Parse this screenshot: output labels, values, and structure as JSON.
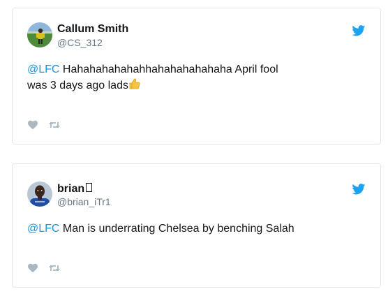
{
  "tweets": [
    {
      "author_name": "Callum Smith",
      "author_handle": "@CS_312",
      "mention": "@LFC",
      "text_line1": " Hahahahahahahhahahahahahaha April fool",
      "text_line2": "was 3 days ago lads"
    },
    {
      "author_name": "brian",
      "author_handle": "@brian_iTr1",
      "mention": "@LFC",
      "text": " Man is underrating Chelsea by benching Salah"
    }
  ],
  "icons": {
    "brand": "twitter-bird-icon",
    "like": "heart-icon",
    "retweet": "retweet-icon",
    "emoji": "thumbs-up-emoji"
  },
  "colors": {
    "twitter_blue": "#1da1f2",
    "mention": "#1b95e0",
    "handle": "#657786",
    "action_icon": "#aab8c2",
    "border": "#e1e8ed"
  }
}
